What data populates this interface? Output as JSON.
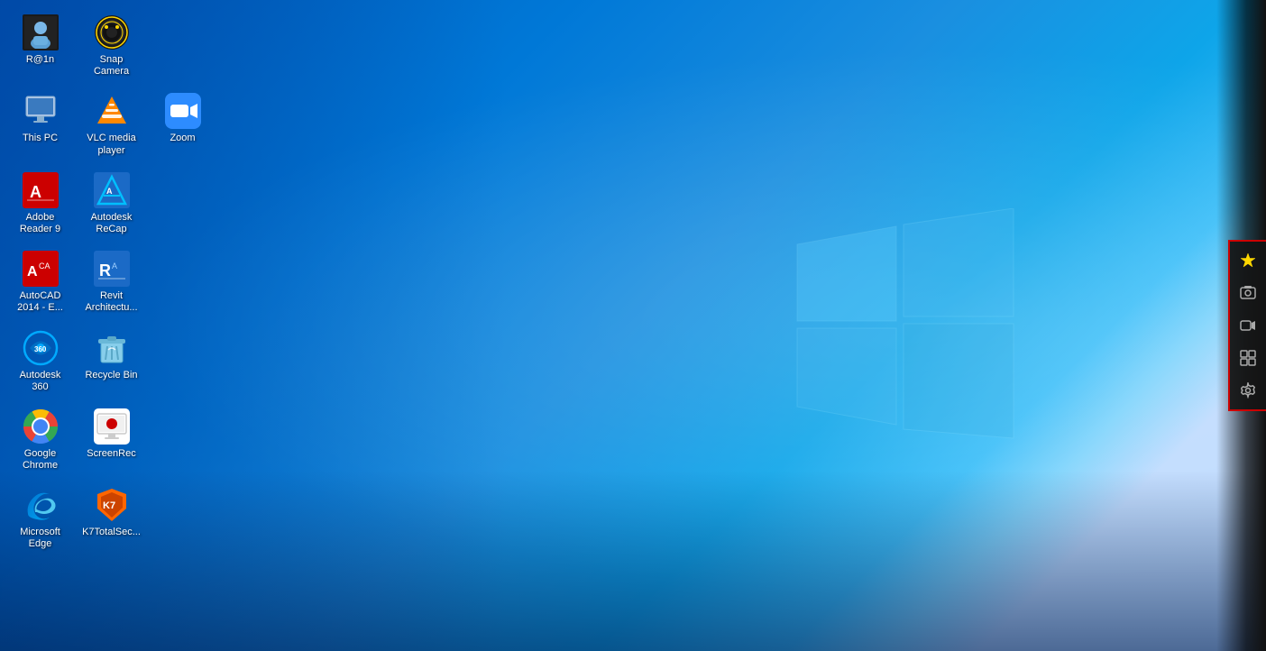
{
  "desktop": {
    "background": "Windows 10 desktop",
    "icons": [
      {
        "id": "user-profile",
        "label": "R@1n",
        "type": "user",
        "row": 0,
        "col": 0
      },
      {
        "id": "snap-camera",
        "label": "Snap Camera",
        "type": "snap",
        "row": 0,
        "col": 1
      },
      {
        "id": "this-pc",
        "label": "This PC",
        "type": "pc",
        "row": 1,
        "col": 0
      },
      {
        "id": "vlc-media-player",
        "label": "VLC media player",
        "type": "vlc",
        "row": 1,
        "col": 1
      },
      {
        "id": "zoom",
        "label": "Zoom",
        "type": "zoom",
        "row": 1,
        "col": 2
      },
      {
        "id": "adobe-reader",
        "label": "Adobe Reader 9",
        "type": "adobe",
        "row": 2,
        "col": 0
      },
      {
        "id": "autodesk-recap",
        "label": "Autodesk ReCap",
        "type": "recap",
        "row": 2,
        "col": 1
      },
      {
        "id": "autocad",
        "label": "AutoCAD 2014 - E...",
        "type": "autocad",
        "row": 3,
        "col": 0
      },
      {
        "id": "revit",
        "label": "Revit Architectu...",
        "type": "revit",
        "row": 3,
        "col": 1
      },
      {
        "id": "autodesk-360",
        "label": "Autodesk 360",
        "type": "a360",
        "row": 4,
        "col": 0
      },
      {
        "id": "recycle-bin",
        "label": "Recycle Bin",
        "type": "recycle",
        "row": 4,
        "col": 1
      },
      {
        "id": "google-chrome",
        "label": "Google Chrome",
        "type": "chrome",
        "row": 5,
        "col": 0
      },
      {
        "id": "screenrec",
        "label": "ScreenRec",
        "type": "screenrec",
        "row": 5,
        "col": 1
      },
      {
        "id": "microsoft-edge",
        "label": "Microsoft Edge",
        "type": "edge",
        "row": 6,
        "col": 0
      },
      {
        "id": "k7-total-security",
        "label": "K7TotalSec...",
        "type": "k7",
        "row": 6,
        "col": 1
      }
    ]
  },
  "toolbar": {
    "buttons": [
      {
        "id": "star",
        "icon": "★",
        "label": "Favorite",
        "active": true
      },
      {
        "id": "camera",
        "icon": "📷",
        "label": "Screenshot"
      },
      {
        "id": "video",
        "icon": "🎬",
        "label": "Record Video"
      },
      {
        "id": "gallery",
        "icon": "🖼",
        "label": "Gallery"
      },
      {
        "id": "settings",
        "icon": "⚙",
        "label": "Settings"
      }
    ]
  }
}
